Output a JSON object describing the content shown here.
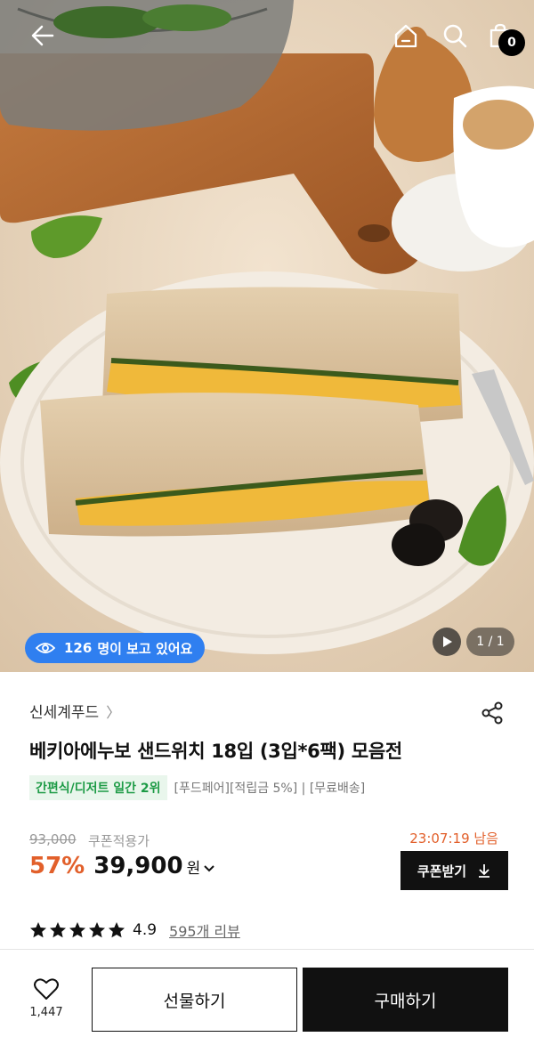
{
  "header": {
    "back_icon": "arrow-left-icon",
    "home_icon": "home-icon",
    "search_icon": "search-icon",
    "cart_icon": "shopping-bag-icon",
    "cart_count": "0"
  },
  "gallery": {
    "viewers_count": "126",
    "viewers_text": "명이 보고 있어요",
    "pager": "1 / 1",
    "play_icon": "play-icon"
  },
  "product": {
    "brand": "신세계푸드",
    "title": "베키아에누보 샌드위치 18입 (3입*6팩) 모음전",
    "rank_badge": "간편식/디저트 일간 2위",
    "tags": "[푸드페어][적립금 5%] | [무료배송]",
    "original_price": "93,000",
    "coupon_label": "쿠폰적용가",
    "timer": "23:07:19 남음",
    "discount": "57%",
    "price": "39,900",
    "currency": "원",
    "coupon_button": "쿠폰받기",
    "rating": "4.9",
    "stars": 5,
    "reviews": "595개 리뷰"
  },
  "bottom": {
    "like_count": "1,447",
    "gift_button": "선물하기",
    "buy_button": "구매하기"
  },
  "colors": {
    "accent_orange": "#e2602b",
    "viewer_blue": "#2f7ff0",
    "rank_green": "#1d9b46",
    "black": "#111111"
  }
}
